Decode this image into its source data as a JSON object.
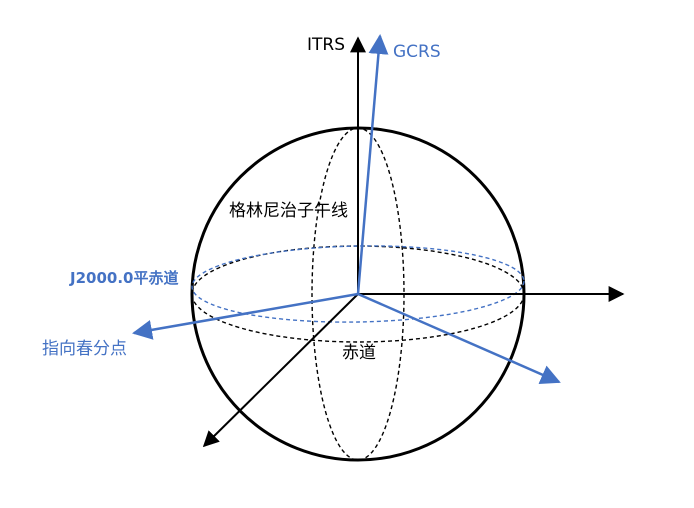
{
  "labels": {
    "itrs": "ITRS",
    "gcrs": "GCRS",
    "greenwich_meridian": "格林尼治子午线",
    "j2000_equator": "J2000.0平赤道",
    "vernal_equinox_direction": "指向春分点",
    "equator": "赤道"
  },
  "colors": {
    "black": "#000000",
    "blue": "#4472C4",
    "background": "#ffffff"
  }
}
